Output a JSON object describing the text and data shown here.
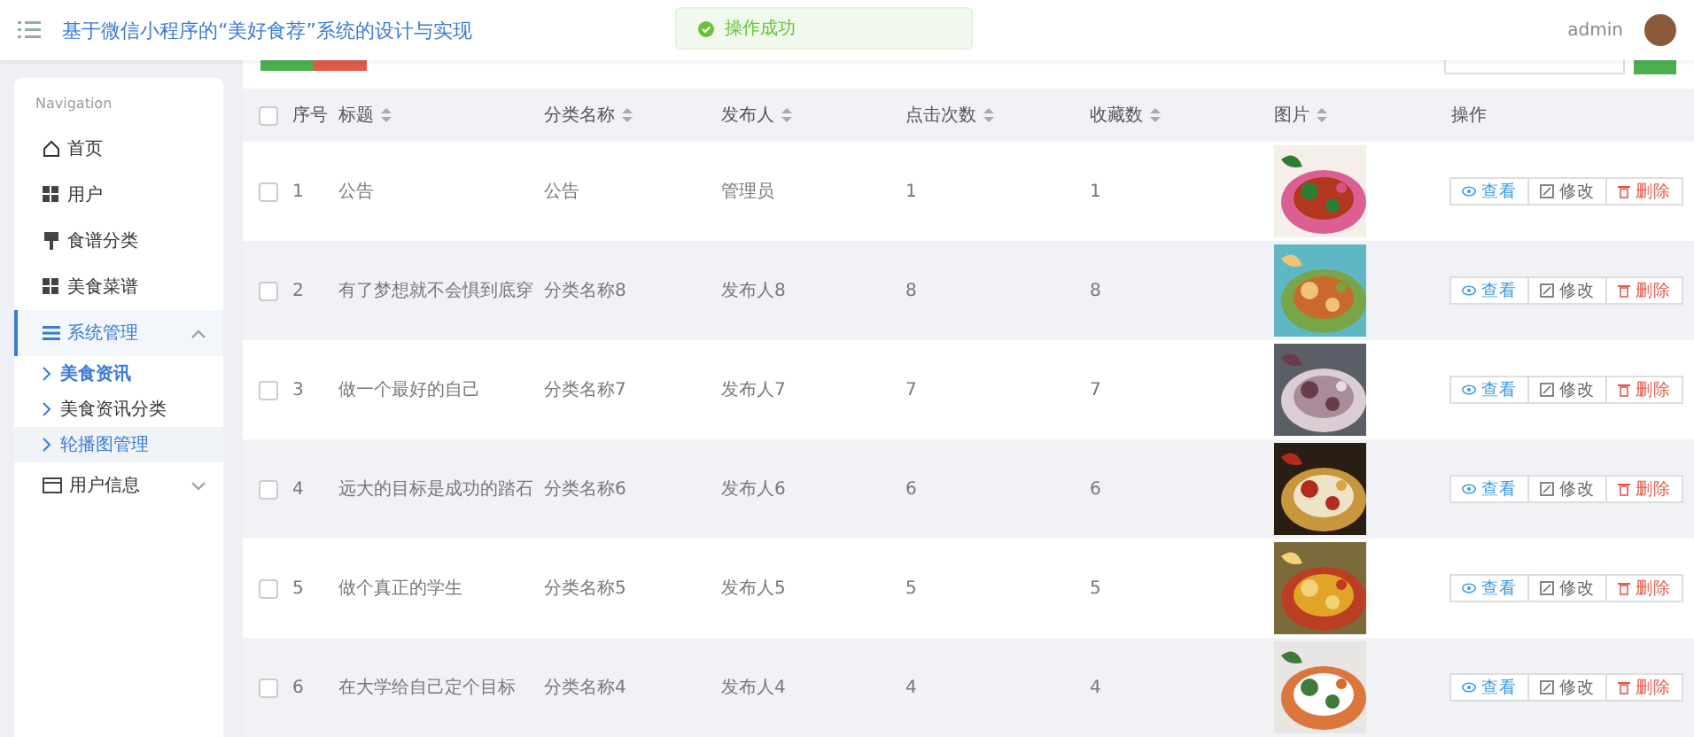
{
  "header": {
    "title": "基于微信小程序的“美好食荐”系统的设计与实现",
    "user": "admin"
  },
  "toast": {
    "message": "操作成功"
  },
  "sidebar": {
    "heading": "Navigation",
    "items": [
      {
        "label": "首页",
        "selected": false
      },
      {
        "label": "用户",
        "selected": false
      },
      {
        "label": "食谱分类",
        "selected": false
      },
      {
        "label": "美食菜谱",
        "selected": false
      },
      {
        "label": "系统管理",
        "selected": true,
        "expanded": true,
        "children": [
          {
            "label": "美食资讯",
            "selected": true,
            "hovered": false
          },
          {
            "label": "美食资讯分类",
            "selected": false,
            "hovered": false
          },
          {
            "label": "轮播图管理",
            "selected": false,
            "hovered": true
          }
        ]
      },
      {
        "label": "用户信息",
        "selected": false,
        "expanded": false
      }
    ]
  },
  "table": {
    "header_checked": false,
    "columns": [
      {
        "label": "序号",
        "sortable": false
      },
      {
        "label": "标题",
        "sortable": true
      },
      {
        "label": "分类名称",
        "sortable": true
      },
      {
        "label": "发布人",
        "sortable": true
      },
      {
        "label": "点击次数",
        "sortable": true
      },
      {
        "label": "收藏数",
        "sortable": true
      },
      {
        "label": "图片",
        "sortable": true
      },
      {
        "label": "操作",
        "sortable": false
      }
    ],
    "rows": [
      {
        "checked": false,
        "cells": [
          "1",
          "公告",
          "公告",
          "管理员",
          "1",
          "1"
        ],
        "actions": [
          {
            "kind": "view",
            "label": "查看"
          },
          {
            "kind": "edit",
            "label": "修改"
          },
          {
            "kind": "delete",
            "label": "删除"
          }
        ]
      },
      {
        "checked": false,
        "cells": [
          "2",
          "有了梦想就不会惧到底穿",
          "分类名称8",
          "发布人8",
          "8",
          "8"
        ],
        "actions": [
          {
            "kind": "view",
            "label": "查看"
          },
          {
            "kind": "edit",
            "label": "修改"
          },
          {
            "kind": "delete",
            "label": "删除"
          }
        ]
      },
      {
        "checked": false,
        "cells": [
          "3",
          "做一个最好的自己",
          "分类名称7",
          "发布人7",
          "7",
          "7"
        ],
        "actions": [
          {
            "kind": "view",
            "label": "查看"
          },
          {
            "kind": "edit",
            "label": "修改"
          },
          {
            "kind": "delete",
            "label": "删除"
          }
        ]
      },
      {
        "checked": false,
        "cells": [
          "4",
          "远大的目标是成功的踏石",
          "分类名称6",
          "发布人6",
          "6",
          "6"
        ],
        "actions": [
          {
            "kind": "view",
            "label": "查看"
          },
          {
            "kind": "edit",
            "label": "修改"
          },
          {
            "kind": "delete",
            "label": "删除"
          }
        ]
      },
      {
        "checked": false,
        "cells": [
          "5",
          "做个真正的学生",
          "分类名称5",
          "发布人5",
          "5",
          "5"
        ],
        "actions": [
          {
            "kind": "view",
            "label": "查看"
          },
          {
            "kind": "edit",
            "label": "修改"
          },
          {
            "kind": "delete",
            "label": "删除"
          }
        ]
      },
      {
        "checked": false,
        "cells": [
          "6",
          "在大学给自己定个目标",
          "分类名称4",
          "发布人4",
          "4",
          "4"
        ],
        "actions": [
          {
            "kind": "view",
            "label": "查看"
          },
          {
            "kind": "edit",
            "label": "修改"
          },
          {
            "kind": "delete",
            "label": "删除"
          }
        ]
      }
    ]
  }
}
